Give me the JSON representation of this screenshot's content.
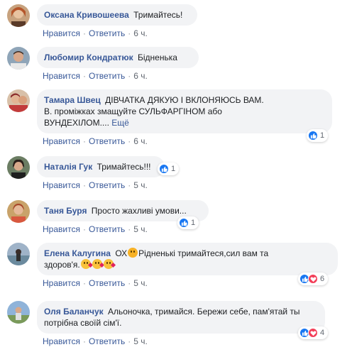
{
  "comments": [
    {
      "name": "Оксана Кривошеева",
      "text": "Тримайтесь!",
      "like": "Нравится",
      "reply": "Ответить",
      "time": "6 ч."
    },
    {
      "name": "Любомир Кондратюк",
      "text": "Бідненька",
      "like": "Нравится",
      "reply": "Ответить",
      "time": "6 ч."
    },
    {
      "name": "Тамара Швец",
      "text_line1": "ДІВЧАТКА ДЯКУЮ І ВКЛОНЯЮСЬ ВАМ.",
      "text_line2": "В. проміжках змащуйте СУЛЬФАРГІНОМ або",
      "text_line3": "ВУНДЕХІЛОМ....",
      "more": "Ещё",
      "like": "Нравится",
      "reply": "Ответить",
      "time": "6 ч.",
      "reaction_count": "1"
    },
    {
      "name": "Наталія Гук",
      "text": "Тримайтесь!!!",
      "like": "Нравится",
      "reply": "Ответить",
      "time": "5 ч.",
      "reaction_count": "1"
    },
    {
      "name": "Таня Буря",
      "text": "Просто жахливі умови...",
      "like": "Нравится",
      "reply": "Ответить",
      "time": "5 ч.",
      "reaction_count": "1"
    },
    {
      "name": "Елена Калугина",
      "text_pre": "ОХ",
      "text_line1": "Рідненькі тримайтеся,сил вам та",
      "text_line2": "здоров'я.",
      "like": "Нравится",
      "reply": "Ответить",
      "time": "5 ч.",
      "reaction_count": "6"
    },
    {
      "name": "Оля Баланчук",
      "text_line1": "Альоночка, тримайся. Бережи себе, пам'ятай ты",
      "text_line2": "потрібна своїй сім'ї.",
      "like": "Нравится",
      "reply": "Ответить",
      "time": "5 ч.",
      "reaction_count": "4"
    }
  ],
  "colors": {
    "name": "#385898",
    "bubble": "#f2f3f5",
    "like": "#1877f2",
    "love": "#f33e58",
    "meta": "#616770"
  },
  "icons": {
    "like": "thumbs-up-icon",
    "love": "heart-icon",
    "sad": "sad-face-emoji",
    "kiss": "kiss-face-emoji"
  }
}
